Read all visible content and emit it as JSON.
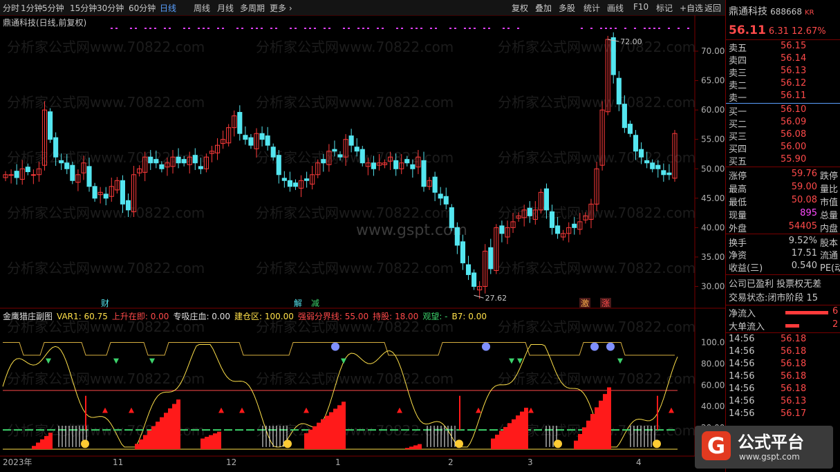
{
  "toolbar": {
    "periods": [
      "分时",
      "1分钟",
      "5分钟",
      "15分钟",
      "30分钟",
      "60分钟",
      "日线",
      "周线",
      "月线",
      "多周期",
      "更多 ›"
    ],
    "active_period": "日线",
    "actions": [
      "复权",
      "叠加",
      "多股",
      "统计",
      "画线",
      "F10",
      "标记",
      "+自选",
      "返回"
    ]
  },
  "chart": {
    "title": "鼎通科技(日线,前复权)",
    "watermark": "分析家公式网www.70822.com",
    "watermark2": "www.gspt.com",
    "price_axis": [
      "70.00",
      "65.00",
      "60.00",
      "55.00",
      "50.00",
      "45.00",
      "40.00",
      "35.00",
      "30.00"
    ],
    "high_label": "72.00",
    "low_label": "27.62",
    "markers": [
      "财",
      "解",
      "减",
      "激",
      "涨"
    ],
    "date_axis": [
      "2023年",
      "11",
      "12",
      "1",
      "2",
      "3",
      "4"
    ]
  },
  "indicator": {
    "name": "金鹰猎庄副图",
    "items": [
      {
        "text": "VAR1: 60.75",
        "color": "#ffe14a"
      },
      {
        "text": "上升在即: 0.00",
        "color": "#ff4a4a"
      },
      {
        "text": "专吸庄血: 0.00",
        "color": "#e0e0e0"
      },
      {
        "text": "建仓区: 100.00",
        "color": "#ffe14a"
      },
      {
        "text": "强弱分界线: 55.00",
        "color": "#ff4a4a"
      },
      {
        "text": "持股: 18.00",
        "color": "#ff4a4a"
      },
      {
        "text": "观望: -",
        "color": "#3cd26b"
      },
      {
        "text": "B7: 0.00",
        "color": "#ffe14a"
      }
    ],
    "axis": [
      "100.00",
      "80.00",
      "60.00",
      "40.00",
      "20.00"
    ]
  },
  "chart_data": {
    "type": "candlestick",
    "x_labels": [
      "2023年",
      "11",
      "12",
      "1",
      "2",
      "3",
      "4"
    ],
    "ylim": [
      27,
      74
    ],
    "series_close_approx": [
      49,
      49,
      48.5,
      50,
      49.5,
      49,
      50,
      60,
      55,
      52,
      51,
      50,
      48,
      49,
      51,
      47,
      45,
      46,
      45,
      47,
      48,
      44,
      43,
      49,
      50,
      52,
      51,
      51,
      50,
      51,
      52,
      51,
      51,
      52,
      51,
      50,
      52,
      53,
      54,
      55,
      57,
      59,
      56,
      55,
      54,
      56,
      55,
      54,
      52,
      49,
      48,
      47,
      47,
      48,
      48,
      49,
      51,
      51,
      53,
      53,
      52,
      55,
      54,
      53,
      51,
      51,
      50,
      51,
      51,
      52,
      50,
      51,
      51,
      50,
      52,
      47,
      48,
      46,
      45,
      44,
      40,
      37,
      34,
      32,
      30,
      30,
      36,
      33,
      40,
      39,
      40,
      41,
      42,
      43,
      42,
      43,
      46,
      43,
      40,
      39,
      39,
      40,
      40,
      41,
      42,
      44,
      50,
      60,
      72,
      66,
      61,
      57,
      56,
      53,
      52,
      51,
      50,
      50,
      49,
      49,
      56
    ]
  },
  "right_panel": {
    "name": "鼎通科技",
    "code": "688668",
    "market": "KR",
    "price": "56.11",
    "change": "6.31",
    "change_pct": "12.67%",
    "sell": [
      {
        "label": "卖五",
        "price": "56.15"
      },
      {
        "label": "卖四",
        "price": "56.14"
      },
      {
        "label": "卖三",
        "price": "56.13"
      },
      {
        "label": "卖二",
        "price": "56.12"
      },
      {
        "label": "卖一",
        "price": "56.11"
      }
    ],
    "buy": [
      {
        "label": "买一",
        "price": "56.10"
      },
      {
        "label": "买二",
        "price": "56.09"
      },
      {
        "label": "买三",
        "price": "56.08"
      },
      {
        "label": "买四",
        "price": "56.00"
      },
      {
        "label": "买五",
        "price": "55.90"
      }
    ],
    "stats": [
      {
        "label": "涨停",
        "value": "59.76",
        "label2": "跌停",
        "color": "#ff4a4a"
      },
      {
        "label": "最高",
        "value": "59.00",
        "label2": "量比",
        "color": "#ff4a4a"
      },
      {
        "label": "最低",
        "value": "50.08",
        "label2": "市值",
        "color": "#ff4a4a"
      },
      {
        "label": "现量",
        "value": "895",
        "label2": "总量",
        "color": "#ff4aff"
      },
      {
        "label": "外盘",
        "value": "54405",
        "label2": "内盘",
        "color": "#ff4a4a"
      }
    ],
    "stats2": [
      {
        "label": "换手",
        "value": "9.52%",
        "label2": "股本"
      },
      {
        "label": "净资",
        "value": "17.51",
        "label2": "流通"
      },
      {
        "label": "收益(三)",
        "value": "0.540",
        "label2": "PE(动"
      }
    ],
    "info1": "公司已盈利 投票权无差",
    "info2": "交易状态:闭市阶段 15",
    "flow1": "净流入",
    "flow2": "大单流入",
    "flow1_val": "6",
    "flow2_val": "2",
    "ticks": [
      {
        "time": "14:56",
        "price": "56.18"
      },
      {
        "time": "14:56",
        "price": "56.18"
      },
      {
        "time": "14:56",
        "price": "56.18"
      },
      {
        "time": "14:56",
        "price": "56.18"
      },
      {
        "time": "14:56",
        "price": "56.18"
      },
      {
        "time": "14:56",
        "price": "56.13"
      },
      {
        "time": "14:56",
        "price": "56.17"
      }
    ]
  },
  "logo": {
    "text": "公式平台",
    "url": "www.gspt.com",
    "mark": "G"
  },
  "colors": {
    "up": "#ff3b3b",
    "down": "#54e6f0",
    "ma": "#ffe14a",
    "bg": "#000000"
  }
}
